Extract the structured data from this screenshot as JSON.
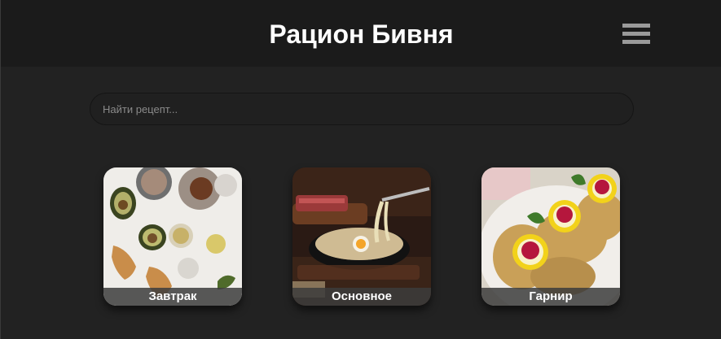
{
  "header": {
    "title": "Рацион Бивня",
    "menu_icon": "hamburger-icon"
  },
  "search": {
    "placeholder": "Найти рецепт..."
  },
  "categories": [
    {
      "label": "Завтрак",
      "image": "breakfast-photo"
    },
    {
      "label": "Основное",
      "image": "main-course-photo"
    },
    {
      "label": "Гарнир",
      "image": "side-dish-photo"
    }
  ],
  "colors": {
    "background": "#222222",
    "header": "#1b1b1b",
    "text": "#ffffff",
    "menu_icon": "#9a9a9a"
  }
}
